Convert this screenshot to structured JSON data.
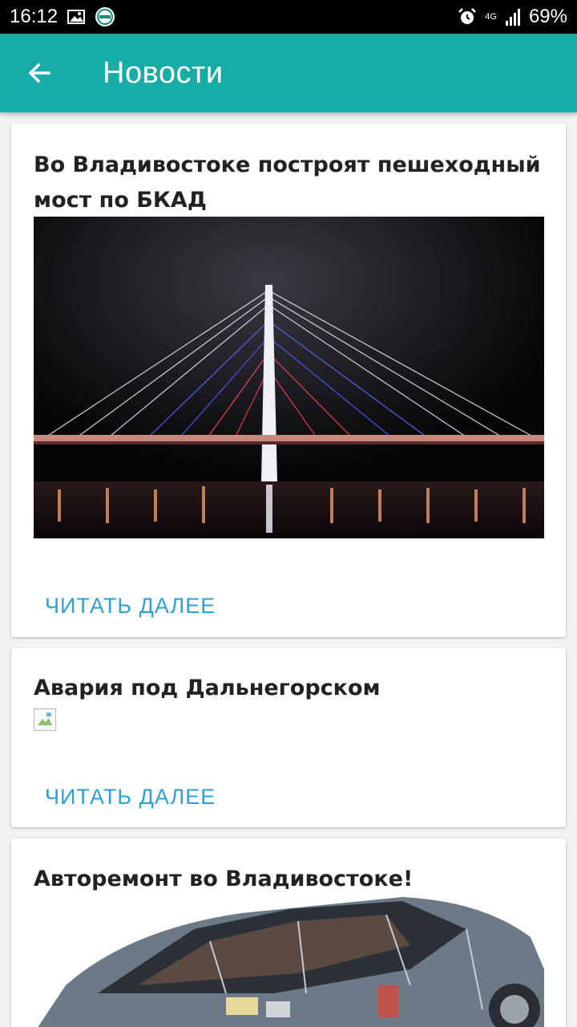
{
  "status_bar": {
    "time": "16:12",
    "network": "4G",
    "battery": "69%"
  },
  "app_bar": {
    "title": "Новости",
    "back_icon": "arrow-left-icon"
  },
  "news": [
    {
      "title": "Во Владивостоке построят пешеходный мост по БКАД",
      "read_more": "ЧИТАТЬ ДАЛЕЕ"
    },
    {
      "title": "Авария под Дальнегорском",
      "read_more": "ЧИТАТЬ ДАЛЕЕ"
    },
    {
      "title": "Авторемонт во Владивостоке!"
    }
  ],
  "colors": {
    "app_bar": "#17ada6",
    "link": "#2f9fd6"
  }
}
